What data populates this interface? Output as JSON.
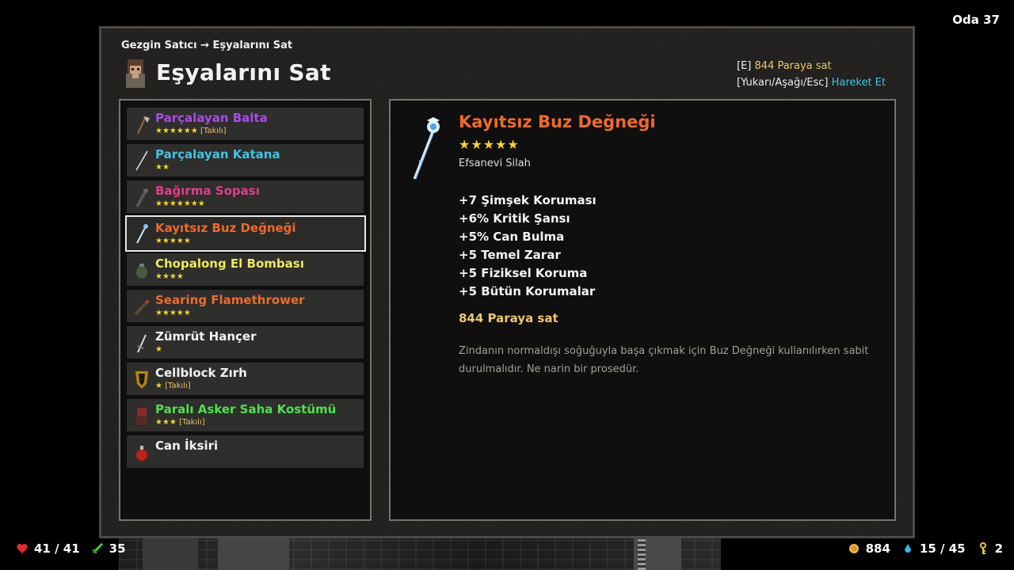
{
  "room": "Oda 37",
  "breadcrumb": "Gezgin Satıcı → Eşyalarını Sat",
  "title": "Eşyalarını Sat",
  "hints": {
    "key_sell": "[E]",
    "sell_text": "844 Paraya sat",
    "key_move": "[Yukarı/Aşağı/Esc]",
    "move_text": "Hareket Et"
  },
  "items": [
    {
      "name": "Parçalayan Balta",
      "stars": "★★★★★★",
      "tag": " [Takılı]",
      "color": "#a94be8",
      "icon": "axe-icon"
    },
    {
      "name": "Parçalayan Katana",
      "stars": "★★",
      "tag": "",
      "color": "#3fc3e6",
      "icon": "katana-icon"
    },
    {
      "name": "Bağırma Sopası",
      "stars": "★★★★★★★",
      "tag": "",
      "color": "#e43c8c",
      "icon": "club-icon"
    },
    {
      "name": "Kayıtsız Buz Değneği",
      "stars": "★★★★★",
      "tag": "",
      "color": "#ee6a2a",
      "icon": "ice-staff-icon"
    },
    {
      "name": "Chopalong El Bombası",
      "stars": "★★★★",
      "tag": "",
      "color": "#ecea5a",
      "icon": "grenade-icon"
    },
    {
      "name": "Searing Flamethrower",
      "stars": "★★★★★",
      "tag": "",
      "color": "#ee6a2a",
      "icon": "flamethrower-icon"
    },
    {
      "name": "Zümrüt Hançer",
      "stars": "★",
      "tag": "",
      "color": "#f2f2f2",
      "icon": "dagger-icon"
    },
    {
      "name": "Cellblock Zırh",
      "stars": "★",
      "tag": " [Takılı]",
      "color": "#f2f2f2",
      "icon": "armor-icon"
    },
    {
      "name": "Paralı Asker Saha Kostümü",
      "stars": "★★★",
      "tag": " [Takılı]",
      "color": "#4fe04f",
      "icon": "costume-icon"
    },
    {
      "name": "Can İksiri",
      "stars": "",
      "tag": "",
      "color": "#f2f2f2",
      "icon": "potion-icon"
    }
  ],
  "detail": {
    "name": "Kayıtsız Buz Değneği",
    "stars": "★★★★★",
    "type": "Efsanevi Silah",
    "stats": [
      "+7 Şimşek Koruması",
      "+6% Kritik Şansı",
      "+5% Can Bulma",
      "+5 Temel Zarar",
      "+5 Fiziksel Koruma",
      "+5 Bütün Korumalar"
    ],
    "sell": "844 Paraya sat",
    "description": "Zindanın normaldışı soğuğuyla başa çıkmak için Buz Değneği kullanılırken sabit durulmalıdır. Ne narin bir prosedür."
  },
  "hud": {
    "health": "41 / 41",
    "attack": "35",
    "gold": "884",
    "mana": "15 / 45",
    "keys": "2"
  }
}
